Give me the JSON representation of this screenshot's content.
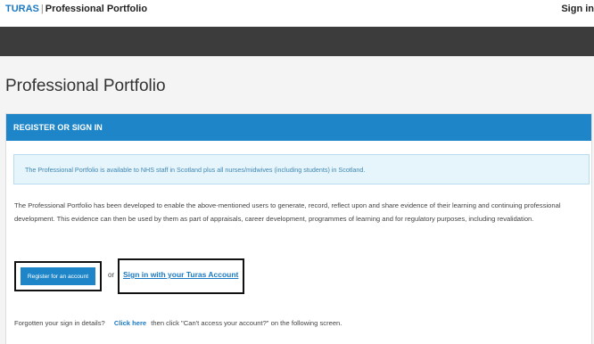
{
  "header": {
    "brand": "TURAS",
    "separator": "|",
    "app_name": "Professional Portfolio",
    "sign_in": "Sign in"
  },
  "page": {
    "title": "Professional Portfolio"
  },
  "panel": {
    "heading": "REGISTER OR SIGN IN",
    "info": "The Professional Portfolio is available to NHS staff in Scotland plus all nurses/midwives (including students) in Scotland.",
    "description": "The Professional Portfolio has been developed to enable the above-mentioned users to generate, record, reflect upon and share evidence of their learning and continuing professional development. This evidence can then be used by them as part of appraisals, career development, programmes of learning and for regulatory purposes, including revalidation.",
    "register_button": "Register for an account",
    "or": "or",
    "signin_link": "Sign in with your Turas Account",
    "forgot_prefix": "Forgotten your sign in details?",
    "forgot_link": "Click here",
    "forgot_suffix": "then click \"Can't access your account?\" on the following screen."
  },
  "colors": {
    "brand_blue": "#1b7ac3",
    "panel_header": "#1e86c8",
    "dark_bar": "#3c3c3c",
    "info_bg": "#e6f4fb"
  }
}
